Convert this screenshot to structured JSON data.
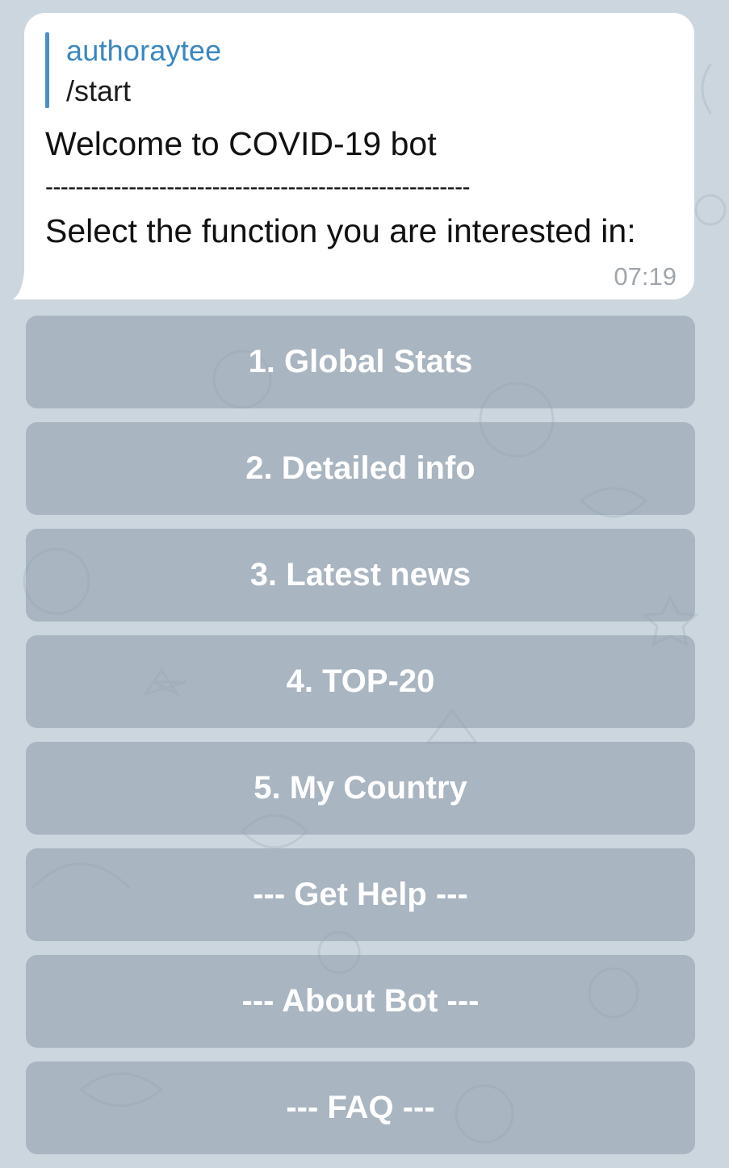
{
  "chat": {
    "message": {
      "reply_to": {
        "author": "authoraytee",
        "text": "/start"
      },
      "title": "Welcome to COVID-19 bot",
      "separator": "--------------------------------------------------------",
      "body": "Select the function you are interested in:",
      "time": "07:19"
    }
  },
  "keyboard": {
    "buttons": [
      {
        "label": "1. Global Stats"
      },
      {
        "label": "2. Detailed info"
      },
      {
        "label": "3. Latest news"
      },
      {
        "label": "4. TOP-20"
      },
      {
        "label": "5. My Country"
      },
      {
        "label": "--- Get Help ---"
      },
      {
        "label": "--- About Bot ---"
      },
      {
        "label": "--- FAQ ---"
      }
    ]
  },
  "colors": {
    "background": "#ccd6de",
    "bubble": "#ffffff",
    "author": "#3a87c2",
    "reply_bar": "#4a90c8",
    "button": "#93a2ae",
    "timestamp": "#a0a6ab"
  }
}
